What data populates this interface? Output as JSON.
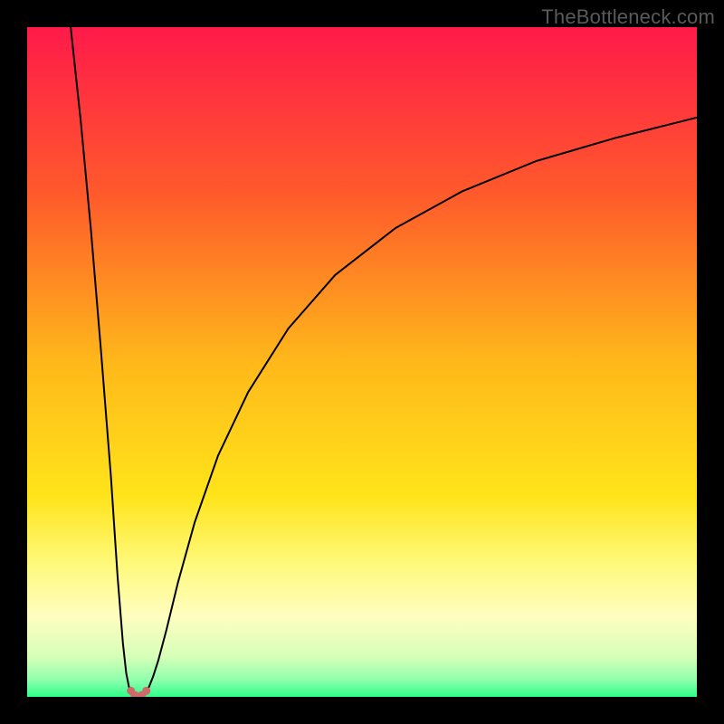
{
  "watermark": "TheBottleneck.com",
  "chart_data": {
    "type": "line",
    "title": "",
    "xlabel": "",
    "ylabel": "",
    "xlim": [
      0,
      100
    ],
    "ylim": [
      0,
      100
    ],
    "background": {
      "type": "vertical-gradient",
      "stops": [
        {
          "t": 0.0,
          "color": "#ff1a4a"
        },
        {
          "t": 0.25,
          "color": "#ff5a2b"
        },
        {
          "t": 0.5,
          "color": "#ffb81a"
        },
        {
          "t": 0.7,
          "color": "#ffe41a"
        },
        {
          "t": 0.8,
          "color": "#fff97a"
        },
        {
          "t": 0.88,
          "color": "#fffec0"
        },
        {
          "t": 0.94,
          "color": "#d6ffb8"
        },
        {
          "t": 0.975,
          "color": "#8fffad"
        },
        {
          "t": 1.0,
          "color": "#2cff8a"
        }
      ]
    },
    "series": [
      {
        "name": "left-branch",
        "color": "#000000",
        "width": 2.0,
        "x": [
          6.5,
          8.0,
          9.5,
          11.0,
          12.5,
          13.5,
          14.3,
          14.8,
          15.2,
          15.5
        ],
        "y": [
          100,
          86,
          70,
          52,
          33,
          18,
          8,
          3.5,
          1.5,
          0.8
        ]
      },
      {
        "name": "right-branch",
        "color": "#000000",
        "width": 2.0,
        "x": [
          17.8,
          18.2,
          18.8,
          19.6,
          20.8,
          22.5,
          25.0,
          28.5,
          33.0,
          39.0,
          46.0,
          55.0,
          65.0,
          76.0,
          88.0,
          100.0
        ],
        "y": [
          0.8,
          1.5,
          3.0,
          5.5,
          10.0,
          17.0,
          26.0,
          36.0,
          45.5,
          55.0,
          63.0,
          70.0,
          75.5,
          80.0,
          83.5,
          86.5
        ]
      },
      {
        "name": "valley-floor",
        "color": "#cf6a6a",
        "width": 5.5,
        "style": "rounded-dots",
        "x": [
          15.5,
          15.8,
          16.3,
          16.8,
          17.3,
          17.8
        ],
        "y": [
          0.8,
          0.3,
          0.1,
          0.1,
          0.3,
          0.8
        ]
      }
    ],
    "valley_dots": {
      "color": "#cf6a6a",
      "radius": 4.5,
      "points": [
        {
          "x": 15.5,
          "y": 0.9
        },
        {
          "x": 16.1,
          "y": 0.25
        },
        {
          "x": 17.1,
          "y": 0.25
        },
        {
          "x": 17.8,
          "y": 0.9
        }
      ]
    }
  }
}
